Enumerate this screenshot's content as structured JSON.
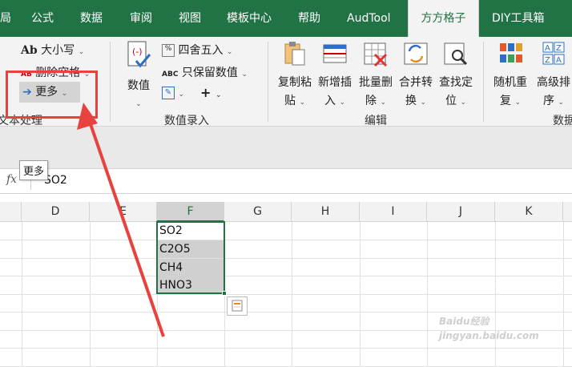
{
  "tabs": {
    "t0": "局",
    "t1": "公式",
    "t2": "数据",
    "t3": "审阅",
    "t4": "视图",
    "t5": "模板中心",
    "t6": "帮助",
    "t7": "AudTool",
    "t8": "方方格子",
    "t9": "DIY工具箱"
  },
  "ribbon": {
    "case_label": "大小写",
    "case_prefix": "Ab",
    "del_space_label": "删除空格",
    "del_space_prefix": "AB",
    "more_label": "更多",
    "text_group": "文本处理",
    "value_label": "数值",
    "round_label": "四舍五入",
    "keep_value_label": "只保留数值",
    "keep_value_prefix": "ABC",
    "value_group": "数值录入",
    "copy_paste": [
      "复制粘",
      "贴"
    ],
    "insert": [
      "新增插",
      "入"
    ],
    "batch_delete": [
      "批量删",
      "除"
    ],
    "merge_convert": [
      "合并转",
      "换"
    ],
    "find_locate": [
      "查找定",
      "位"
    ],
    "edit_group": "编辑",
    "random": [
      "随机重",
      "复"
    ],
    "sort": [
      "高级排",
      "序"
    ],
    "data_group": "数据"
  },
  "tooltip": "更多",
  "formula_bar": {
    "fx": "fx",
    "content": "SO2"
  },
  "columns": [
    "D",
    "E",
    "F",
    "G",
    "H",
    "I",
    "J",
    "K"
  ],
  "cells": [
    "SO2",
    "C2O5",
    "CH4",
    "HNO3"
  ],
  "colors": {
    "accent": "#217346",
    "annotation": "#e8423f"
  },
  "watermark": "Baidu经验 jingyan.baidu.com"
}
